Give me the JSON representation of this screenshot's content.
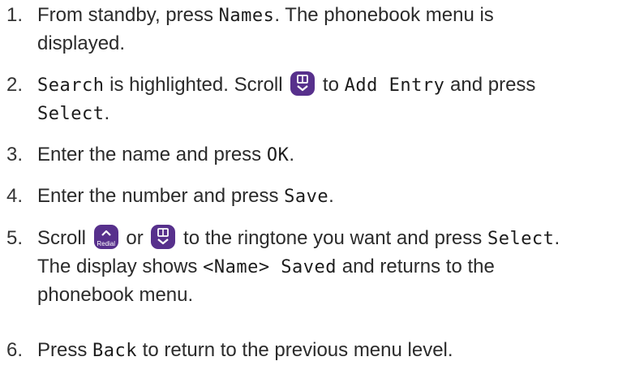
{
  "steps": [
    {
      "num": "1.",
      "t1": "From standby, press ",
      "k1": "Names",
      "t2": ". The phonebook menu is",
      "t3": "displayed."
    },
    {
      "num": "2.",
      "k1": "Search",
      "t1": " is highlighted. Scroll ",
      "t2": " to ",
      "k2": "Add Entry",
      "t3": " and press",
      "k3": "Select",
      "t4": "."
    },
    {
      "num": "3.",
      "t1": "Enter the name and press ",
      "k1": "OK",
      "t2": "."
    },
    {
      "num": "4.",
      "t1": "Enter the number and press ",
      "k1": "Save",
      "t2": "."
    },
    {
      "num": "5.",
      "t1": "Scroll ",
      "t2": " or ",
      "t3": " to the ringtone you want and press ",
      "k1": "Select",
      "t4": ".",
      "t5": "The display shows ",
      "k2": "<Name> Saved",
      "t6": " and returns to the",
      "t7": "phonebook menu."
    },
    {
      "num": "6.",
      "t1": "Press ",
      "k1": "Back",
      "t2": " to return to the previous menu level."
    }
  ],
  "keys": {
    "phonebook_icon": "phonebook-down-key-icon",
    "redial_icon": "redial-up-key-icon",
    "redial_label": "Redial",
    "key_color": "#57308c"
  }
}
